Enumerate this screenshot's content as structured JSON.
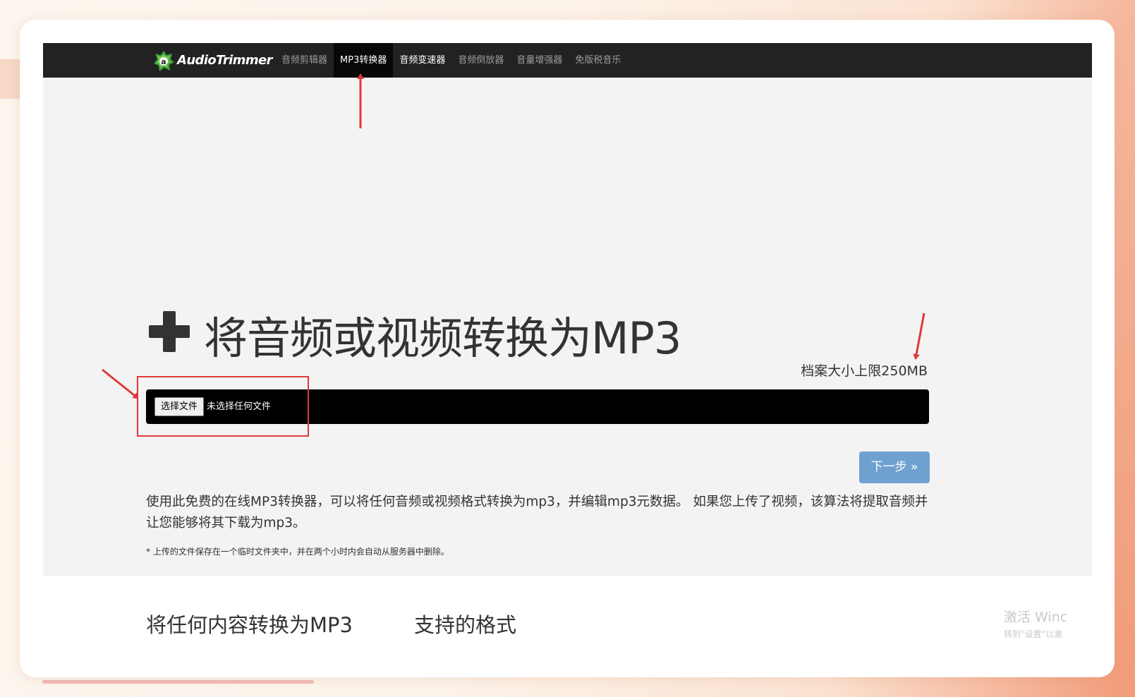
{
  "app": {
    "brand": "AudioTrimmer",
    "accent_color": "#6fa1d0",
    "navbar_color": "#222222"
  },
  "nav": {
    "items": [
      {
        "label": "音频剪辑器",
        "active": false
      },
      {
        "label": "MP3转换器",
        "active": true
      },
      {
        "label": "音频变速器",
        "active": false
      },
      {
        "label": "音频倒放器",
        "active": false
      },
      {
        "label": "音量增强器",
        "active": false
      },
      {
        "label": "免版税音乐",
        "active": false
      }
    ]
  },
  "hero": {
    "icon": "plus-icon",
    "title": "将音频或视频转换为MP3",
    "size_limit": "档案大小上限250MB"
  },
  "file_input": {
    "button_label": "选择文件",
    "status": "未选择任何文件"
  },
  "next_button": {
    "label": "下一步 »"
  },
  "description": {
    "text": "使用此免费的在线MP3转换器，可以将任何音频或视频格式转换为mp3，并编辑mp3元数据。 如果您上传了视频，该算法将提取音频并让您能够将其下载为mp3。",
    "note": "* 上传的文件保存在一个临时文件夹中，并在两个小时内会自动从服务器中删除。"
  },
  "sections": {
    "convert_heading": "将任何内容转换为MP3",
    "formats_heading": "支持的格式"
  },
  "watermark": {
    "line1": "激活 Winc",
    "line2": "转到\"设置\"以激"
  },
  "annotations": {
    "color": "#e0373b"
  }
}
